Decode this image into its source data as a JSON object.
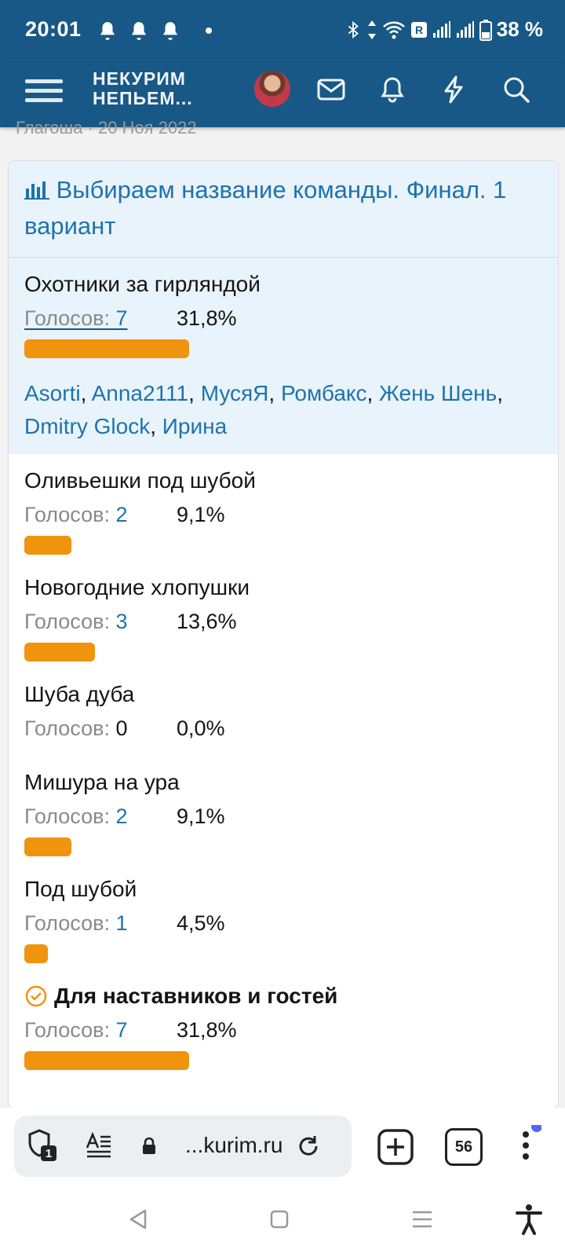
{
  "status": {
    "time": "20:01",
    "battery": "38 %",
    "notifications": [
      "bell-icon",
      "bell-icon",
      "bell-icon"
    ]
  },
  "appbar": {
    "logo_line1": "НЕКУРИМ",
    "logo_line2": "НЕПЬЕМ..."
  },
  "behind_meta": "Глагоша · 20 Ноя 2022",
  "poll": {
    "title": "Выбираем название команды. Финал. 1 вариант",
    "votes_label": "Голосов: ",
    "options": [
      {
        "name": "Охотники за гирляндой",
        "votes": "7",
        "percent": "31,8%",
        "share": 0.318,
        "voters": [
          "Asorti",
          "Anna2111",
          "МусяЯ",
          "Ромбакс",
          "Жень Шень",
          "Dmitry Glock",
          "Ирина"
        ]
      },
      {
        "name": "Оливьешки под шубой",
        "votes": "2",
        "percent": "9,1%",
        "share": 0.091
      },
      {
        "name": "Новогодние хлопушки",
        "votes": "3",
        "percent": "13,6%",
        "share": 0.136
      },
      {
        "name": "Шуба дуба",
        "votes": "0",
        "percent": "0,0%",
        "share": 0.0
      },
      {
        "name": "Мишура на ура",
        "votes": "2",
        "percent": "9,1%",
        "share": 0.091
      },
      {
        "name": "Под шубой",
        "votes": "1",
        "percent": "4,5%",
        "share": 0.045
      },
      {
        "name": "Для наставников и гостей",
        "votes": "7",
        "percent": "31,8%",
        "share": 0.318
      }
    ]
  },
  "browser": {
    "url": "...kurim.ru",
    "tab_count": "56",
    "shield_badge": "1"
  },
  "colors": {
    "header": "#185886",
    "link": "#1e73ad",
    "bar": "#f0930d",
    "highlight": "#e9f3fb"
  }
}
